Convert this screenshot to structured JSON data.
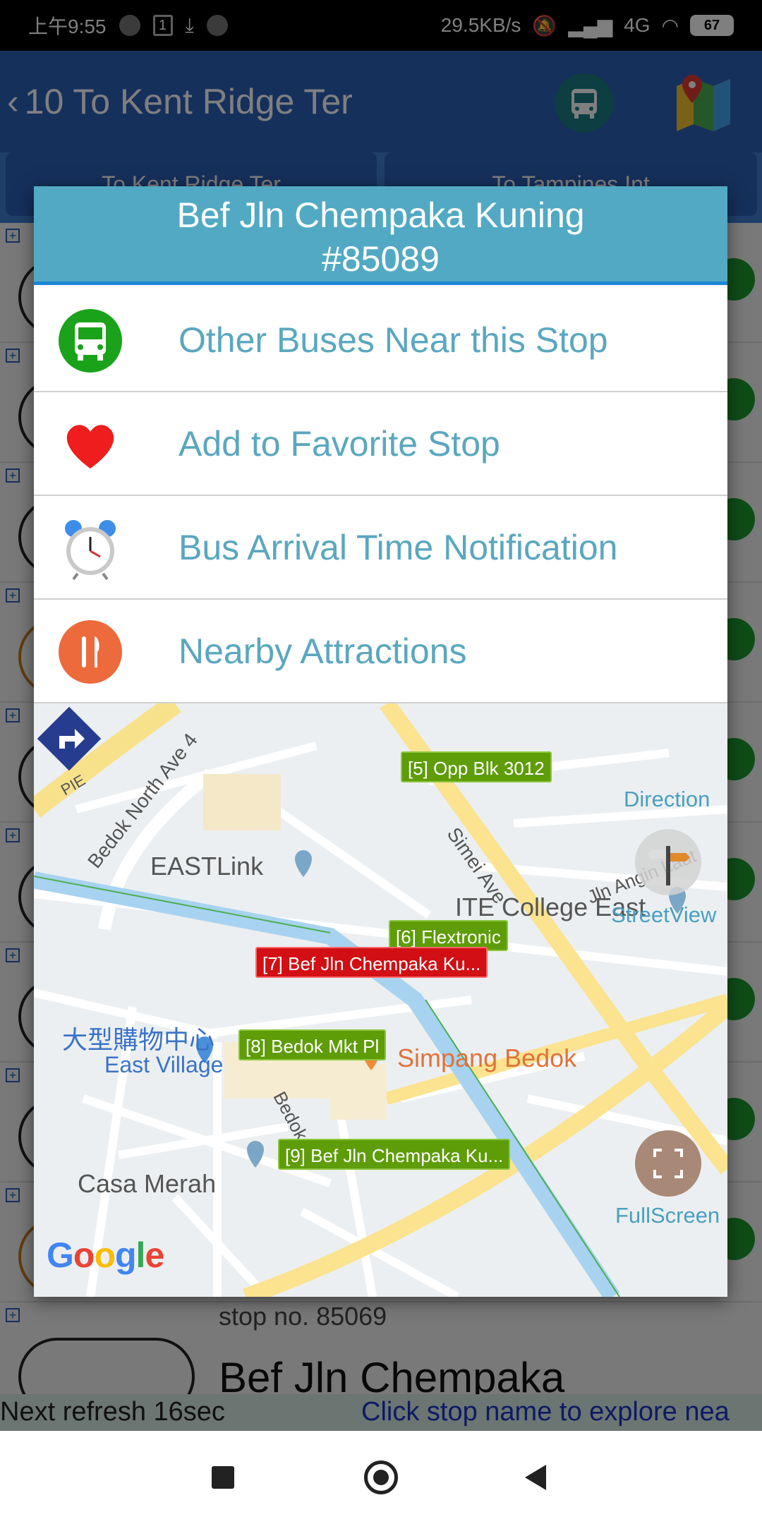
{
  "status_bar": {
    "time": "上午9:55",
    "badge": "1",
    "speed": "29.5KB/s",
    "network": "4G",
    "battery": "67"
  },
  "header": {
    "title": "10 To Kent Ridge Ter"
  },
  "tabs": [
    {
      "label": "To Kent Ridge Ter"
    },
    {
      "label": "To Tampines Int"
    }
  ],
  "background": {
    "stop_no": "stop no. 85069",
    "stop_name": "Bef Jln Chempaka"
  },
  "footer": {
    "refresh": "Next refresh 16sec",
    "hint": "Click stop name to explore nea"
  },
  "dialog": {
    "title_line1": "Bef Jln Chempaka Kuning",
    "title_line2": "#85089",
    "menu": [
      {
        "label": "Other Buses Near this Stop",
        "icon": "bus-icon"
      },
      {
        "label": "Add to Favorite Stop",
        "icon": "heart-icon"
      },
      {
        "label": "Bus Arrival Time Notification",
        "icon": "alarm-clock-icon"
      },
      {
        "label": "Nearby Attractions",
        "icon": "restaurant-icon"
      }
    ]
  },
  "map": {
    "labels": {
      "pie": "PIE",
      "bedok_north": "Bedok North Ave 4",
      "eastlink": "EASTLink",
      "simei_ave": "Simei Ave",
      "jln_angin_laut": "Jln Angin Laut",
      "ite": "ITE College East",
      "east_village_cn": "大型購物中心",
      "east_village": "East Village",
      "simpang_bedok": "Simpang Bedok",
      "bedok_rd": "Bedok Rd",
      "casa_merah": "Casa Merah"
    },
    "markers": [
      {
        "label": "[5] Opp Blk 3012"
      },
      {
        "label": "[6] Flextronic"
      },
      {
        "label": "[7] Bef Jln Chempaka Ku..."
      },
      {
        "label": "[8] Bedok Mkt Pl"
      },
      {
        "label": "[9] Bef Jln Chempaka Ku..."
      }
    ],
    "direction_label": "Direction",
    "streetview_label": "StreetView",
    "fullscreen_label": "FullScreen",
    "google": "Google"
  }
}
